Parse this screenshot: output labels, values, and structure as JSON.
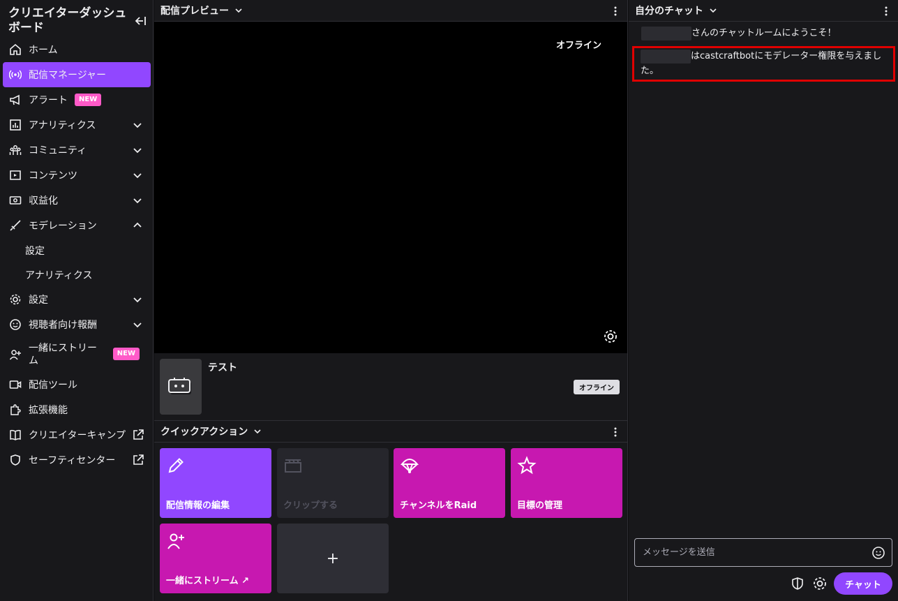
{
  "sidebar": {
    "title": "クリエイターダッシュボード",
    "items": [
      {
        "label": "ホーム"
      },
      {
        "label": "配信マネージャー"
      },
      {
        "label": "アラート",
        "badge": "NEW"
      },
      {
        "label": "アナリティクス"
      },
      {
        "label": "コミュニティ"
      },
      {
        "label": "コンテンツ"
      },
      {
        "label": "収益化"
      },
      {
        "label": "モデレーション"
      },
      {
        "label": "設定"
      },
      {
        "label": "アナリティクス"
      },
      {
        "label": "設定"
      },
      {
        "label": "視聴者向け報酬"
      },
      {
        "label": "一緒にストリーム",
        "badge": "NEW"
      },
      {
        "label": "配信ツール"
      },
      {
        "label": "拡張機能"
      },
      {
        "label": "クリエイターキャンプ"
      },
      {
        "label": "セーフティセンター"
      }
    ]
  },
  "preview": {
    "title": "配信プレビュー",
    "status": "オフライン",
    "stream_title": "テスト",
    "status_pill": "オフライン"
  },
  "quick_actions": {
    "title": "クイックアクション",
    "tiles": [
      {
        "label": "配信情報の編集",
        "icon": "pencil-icon",
        "color": "#9147ff"
      },
      {
        "label": "クリップする",
        "icon": "clapper-icon",
        "color": "#26262c"
      },
      {
        "label": "チャンネルをRaid",
        "icon": "parachute-icon",
        "color": "#c718b0"
      },
      {
        "label": "目標の管理",
        "icon": "star-icon",
        "color": "#c718b0"
      },
      {
        "label": "一緒にストリーム ↗",
        "icon": "add-user-icon",
        "color": "#c718b0"
      },
      {
        "label": "+",
        "icon": "plus-icon",
        "color": "#2e2e35"
      }
    ]
  },
  "chat": {
    "title": "自分のチャット",
    "messages": [
      {
        "text": "さんのチャットルームにようこそ！"
      },
      {
        "text": "はcastcraftbotにモデレーター権限を与えました。"
      }
    ],
    "input_placeholder": "メッセージを送信",
    "send_label": "チャット"
  },
  "colors": {
    "accent": "#9147ff",
    "magenta": "#c718b0",
    "badge": "#ff5ac8",
    "highlight": "#e00000"
  }
}
